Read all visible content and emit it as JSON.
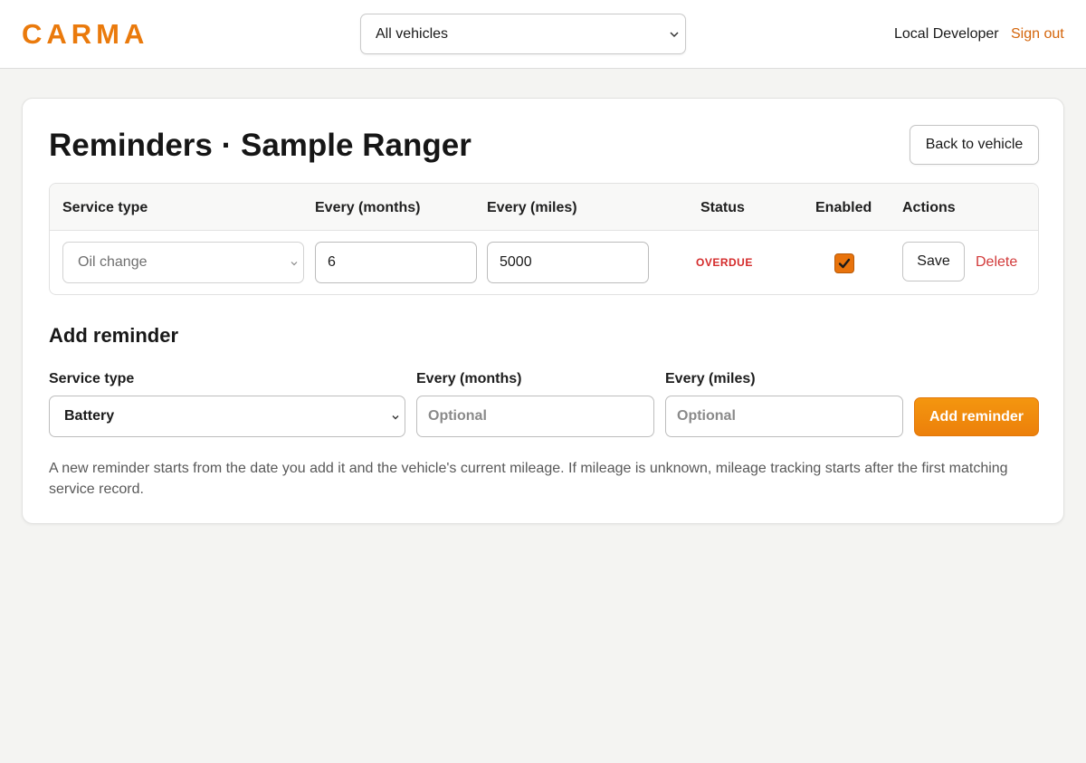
{
  "header": {
    "brand": "CARMA",
    "vehicle_filter": "All vehicles",
    "user_name": "Local Developer",
    "sign_out": "Sign out"
  },
  "page": {
    "title": "Reminders · Sample Ranger",
    "back_button": "Back to vehicle"
  },
  "table": {
    "columns": [
      "Service type",
      "Every (months)",
      "Every (miles)",
      "Status",
      "Enabled",
      "Actions"
    ],
    "rows": [
      {
        "service_type": "Oil change",
        "months": "6",
        "miles": "5000",
        "status": "OVERDUE",
        "enabled": true,
        "save_label": "Save",
        "delete_label": "Delete"
      }
    ]
  },
  "add_reminder": {
    "title": "Add reminder",
    "service_type_label": "Service type",
    "service_type_value": "Battery",
    "months_label": "Every (months)",
    "months_placeholder": "Optional",
    "miles_label": "Every (miles)",
    "miles_placeholder": "Optional",
    "button_label": "Add reminder",
    "helper_text": "A new reminder starts from the date you add it and the vehicle's current mileage. If mileage is unknown, mileage tracking starts after the first matching service record."
  },
  "colors": {
    "accent": "#ea7a0c",
    "danger": "#d42b2b",
    "background": "#f4f4f2"
  },
  "icons": {
    "select_chevron": "chevron-down-icon",
    "checkbox_check": "checkmark-icon"
  }
}
